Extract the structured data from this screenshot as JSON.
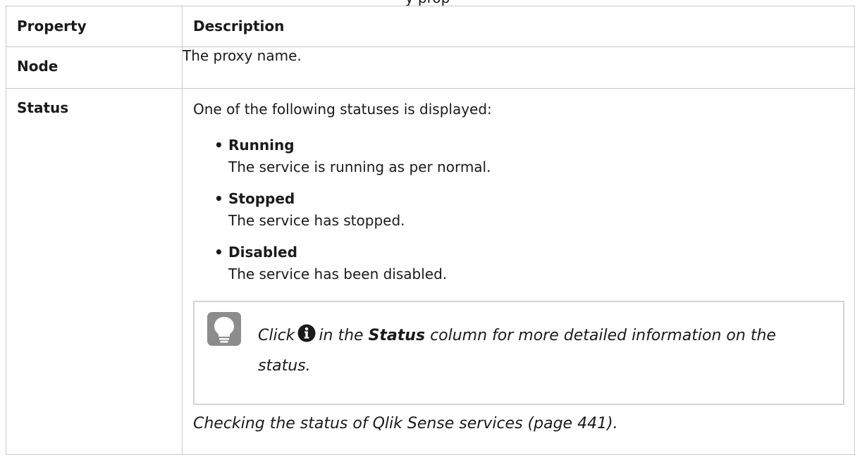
{
  "caption": "y prop",
  "table": {
    "headers": [
      "Property",
      "Description"
    ],
    "rows": [
      {
        "key": "Node",
        "value": "The proxy name."
      }
    ]
  },
  "status_row": {
    "key": "Status",
    "intro": "One of the following statuses is displayed:",
    "bullet_char": "•",
    "items": [
      {
        "name": "Running",
        "desc": "The service is running as per normal."
      },
      {
        "name": "Stopped",
        "desc": "The service has stopped."
      },
      {
        "name": "Disabled",
        "desc": "The service has been disabled."
      }
    ],
    "tip": {
      "icon": "lightbulb-icon",
      "prefix": "Click",
      "inline_icon": "info-icon",
      "mid": "in the",
      "bold": "Status",
      "suffix": "column for more detailed information on the status."
    },
    "link": "Checking the status of Qlik Sense services (page 441)."
  },
  "colors": {
    "border": "#c8c8c8",
    "tip_border": "#d4d4d4",
    "tip_icon_bg": "#8c8c8c",
    "text": "#1a1a1a"
  }
}
